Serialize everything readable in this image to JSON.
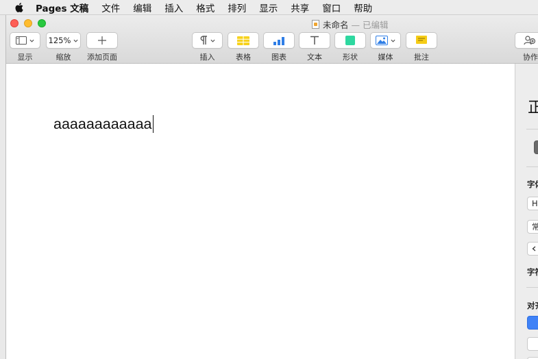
{
  "menubar": {
    "app_name": "Pages 文稿",
    "items": [
      "文件",
      "编辑",
      "插入",
      "格式",
      "排列",
      "显示",
      "共享",
      "窗口",
      "帮助"
    ]
  },
  "window": {
    "title": "未命名",
    "status": "— 已编辑"
  },
  "toolbar": {
    "view_label": "显示",
    "zoom_value": "125%",
    "zoom_label": "缩放",
    "add_page_label": "添加页面",
    "insert_label": "插入",
    "table_label": "表格",
    "chart_label": "图表",
    "text_label": "文本",
    "shape_label": "形状",
    "media_label": "媒体",
    "comment_label": "批注",
    "collaborate_label": "协作"
  },
  "document": {
    "body_text": "aaaaaaaaaaaa"
  },
  "sidebar": {
    "style_title": "正",
    "font_label": "字体",
    "font_value": "H",
    "font_style_value": "常",
    "char_style_label": "字符",
    "align_label": "对齐"
  },
  "colors": {
    "shape_green": "#2ed8a0",
    "table_yellow": "#f7d21c",
    "chart_blue": "#2f7ee6",
    "comment_yellow": "#f5cc16",
    "align_blue": "#3f82f7"
  }
}
